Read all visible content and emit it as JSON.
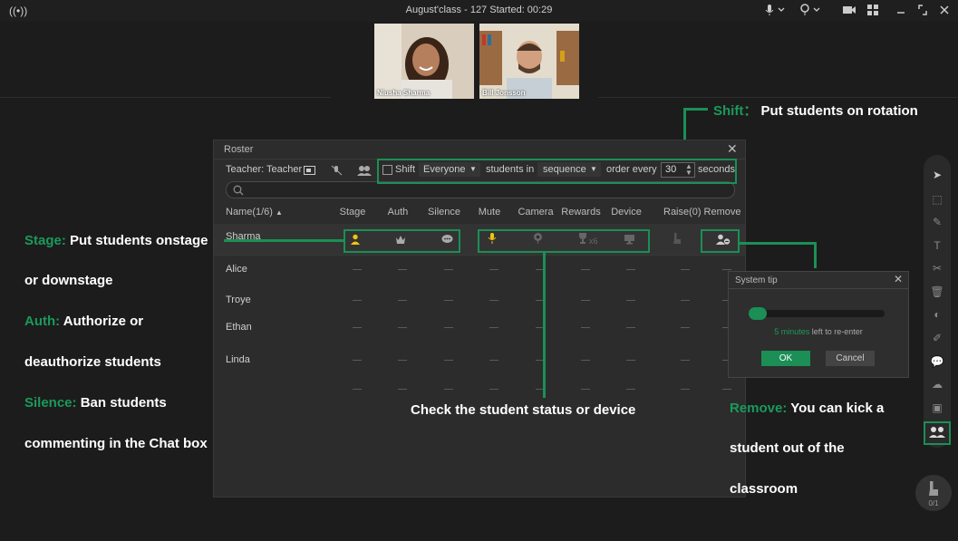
{
  "window": {
    "title": "August'class - 127   Started: 00:29",
    "icons": [
      "broadcast-icon",
      "mic-icon",
      "camera-mic-icon",
      "video-icon",
      "grid-icon",
      "shrink-icon",
      "expand-icon",
      "close-icon"
    ]
  },
  "videos": [
    {
      "name": "Niusha Sharma"
    },
    {
      "name": "Bill Jonsson"
    }
  ],
  "roster": {
    "title": "Roster",
    "teacher_label": "Teacher: Teacher",
    "shift_label": "Shift",
    "shift_target": "Everyone",
    "students_in_label": "students in",
    "order_mode": "sequence",
    "order_every_label": "order every",
    "order_every_value": "30",
    "seconds_label": "seconds",
    "columns": [
      "Name(1/6)",
      "Stage",
      "Auth",
      "Silence",
      "Mute",
      "Camera",
      "Rewards",
      "Device",
      "Raise(0)",
      "Remove"
    ],
    "students": [
      "Sharma",
      "Alice",
      "Troye",
      "Ethan",
      "Linda"
    ],
    "rewards_count": "x6"
  },
  "system_tip": {
    "title": "System tip",
    "minutes": "5 minutes",
    "left_text": "left to re-enter",
    "ok_label": "OK",
    "cancel_label": "Cancel"
  },
  "sidebar": {
    "raise_count": "0/1"
  },
  "annotations": {
    "shift_key": "Shift：",
    "shift_text": "Put students on rotation",
    "stage_key": "Stage:",
    "stage_text1": "Put students onstage",
    "stage_text2": "or downstage",
    "auth_key": "Auth:",
    "auth_text1": "Authorize or",
    "auth_text2": "deauthorize students",
    "silence_key": "Silence:",
    "silence_text1": "Ban students",
    "silence_text2": "commenting in the Chat box",
    "check_text": "Check the student status or device",
    "remove_key": "Remove:",
    "remove_text1": "You can kick a",
    "remove_text2": "student out of the",
    "remove_text3": "classroom"
  },
  "colors": {
    "accent_green": "#1b8f55",
    "annotation_green": "#1a9a5a",
    "stage_yellow": "#f1c40f",
    "background": "#1c1c1c"
  }
}
